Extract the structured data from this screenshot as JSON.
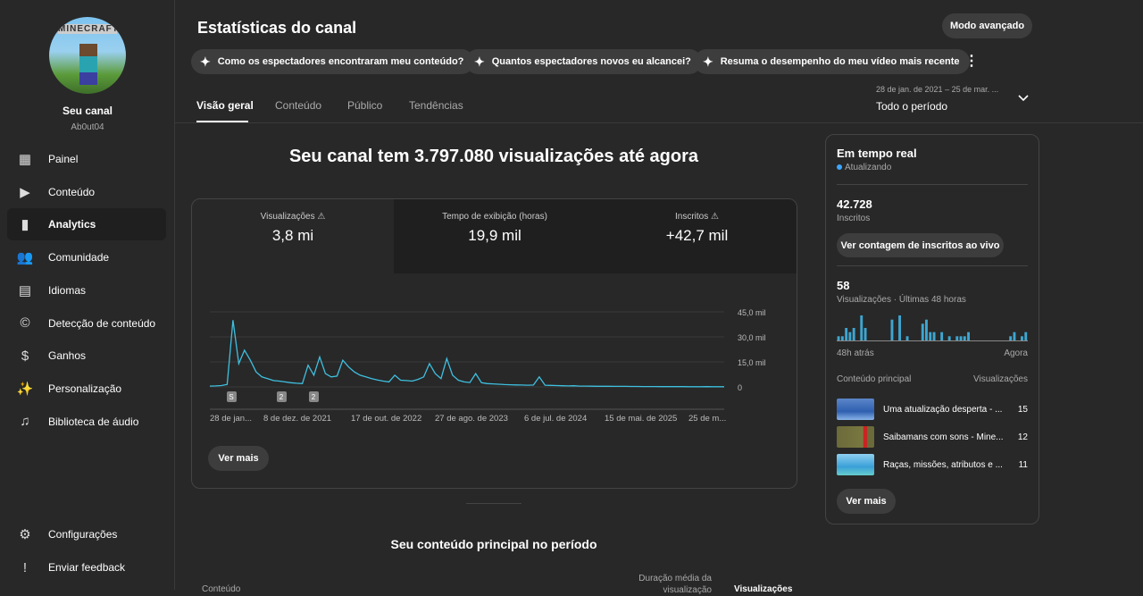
{
  "sidebar": {
    "avatar_logo": "MINECRAFT",
    "channel_name": "Seu canal",
    "channel_handle": "Ab0ut04",
    "items": [
      {
        "label": "Painel",
        "icon": "dashboard-icon"
      },
      {
        "label": "Conteúdo",
        "icon": "content-icon"
      },
      {
        "label": "Analytics",
        "icon": "analytics-icon"
      },
      {
        "label": "Comunidade",
        "icon": "community-icon"
      },
      {
        "label": "Idiomas",
        "icon": "subtitles-icon"
      },
      {
        "label": "Detecção de conteúdo",
        "icon": "copyright-icon"
      },
      {
        "label": "Ganhos",
        "icon": "dollar-icon"
      },
      {
        "label": "Personalização",
        "icon": "magic-wand-icon"
      },
      {
        "label": "Biblioteca de áudio",
        "icon": "audio-library-icon"
      }
    ],
    "bottom": [
      {
        "label": "Configurações",
        "icon": "gear-icon"
      },
      {
        "label": "Enviar feedback",
        "icon": "feedback-icon"
      }
    ]
  },
  "header": {
    "title": "Estatísticas do canal",
    "advanced_mode": "Modo avançado",
    "chips": [
      "Como os espectadores encontraram meu conteúdo?",
      "Quantos espectadores novos eu alcancei?",
      "Resuma o desempenho do meu vídeo mais recente"
    ],
    "tabs": [
      "Visão geral",
      "Conteúdo",
      "Público",
      "Tendências"
    ],
    "period_range": "28 de jan. de 2021 – 25 de mar. ...",
    "period_label": "Todo o período"
  },
  "overview": {
    "headline": "Seu canal tem 3.797.080 visualizações até agora",
    "metrics": [
      {
        "label": "Visualizações",
        "value": "3,8 mi"
      },
      {
        "label": "Tempo de exibição (horas)",
        "value": "19,9 mil"
      },
      {
        "label": "Inscritos",
        "value": "+42,7 mil"
      }
    ],
    "see_more": "Ver mais"
  },
  "chart_data": {
    "type": "line",
    "title": "Visualizações",
    "ylim": [
      0,
      45000
    ],
    "y_ticks": [
      "45,0 mil",
      "30,0 mil",
      "15,0 mil",
      "0"
    ],
    "y_tick_values": [
      45000,
      30000,
      15000,
      0
    ],
    "x_ticks": [
      "28 de jan...",
      "8 de dez. de 2021",
      "17 de out. de 2022",
      "27 de ago. de 2023",
      "6 de jul. de 2024",
      "15 de mai. de 2025",
      "25 de m..."
    ],
    "markers": [
      "S",
      "2",
      "2"
    ],
    "color": "#3ec0e0",
    "values": [
      500,
      600,
      800,
      1500,
      40000,
      14000,
      22000,
      16000,
      9000,
      6000,
      5000,
      3800,
      3500,
      3000,
      2500,
      2200,
      2000,
      13000,
      7000,
      18000,
      8000,
      6000,
      6500,
      16000,
      12000,
      9000,
      7000,
      6000,
      5000,
      4200,
      3500,
      3000,
      7000,
      4000,
      3800,
      3500,
      4500,
      6000,
      14000,
      8000,
      5000,
      17000,
      7000,
      4000,
      3000,
      2600,
      8000,
      2500,
      2000,
      1800,
      1600,
      1400,
      1300,
      1200,
      1100,
      1000,
      1100,
      6000,
      1000,
      900,
      800,
      700,
      600,
      700,
      500,
      500,
      450,
      400,
      400,
      350,
      300,
      300,
      300,
      250,
      250,
      200,
      200,
      200,
      150,
      200,
      150,
      150,
      150,
      120,
      120,
      100,
      150,
      100,
      100,
      100
    ]
  },
  "realtime": {
    "title": "Em tempo real",
    "status": "Atualizando",
    "subscribers": "42.728",
    "subscribers_label": "Inscritos",
    "live_count_button": "Ver contagem de inscritos ao vivo",
    "views": "58",
    "views_label": "Visualizações · Últimas 48 horas",
    "start_label": "48h atrás",
    "end_label": "Agora",
    "bars": [
      1,
      1,
      3,
      2,
      3,
      0,
      6,
      3,
      0,
      0,
      0,
      0,
      0,
      0,
      5,
      0,
      6,
      0,
      1,
      0,
      0,
      0,
      4,
      5,
      2,
      2,
      0,
      2,
      0,
      1,
      0,
      1,
      1,
      1,
      2,
      0,
      0,
      0,
      0,
      0,
      0,
      0,
      0,
      0,
      0,
      1,
      2,
      0,
      1,
      2
    ],
    "content_header": "Conteúdo principal",
    "views_header": "Visualizações",
    "top": [
      {
        "title": "Uma atualização desperta - ...",
        "views": "15"
      },
      {
        "title": "Saibamans com sons - Mine...",
        "views": "12"
      },
      {
        "title": "Raças, missões, atributos e ...",
        "views": "11"
      }
    ],
    "see_more": "Ver mais"
  },
  "top_content": {
    "title": "Seu conteúdo principal no período",
    "col_content": "Conteúdo",
    "col_duration": "Duração média da visualização",
    "col_views": "Visualizações"
  }
}
